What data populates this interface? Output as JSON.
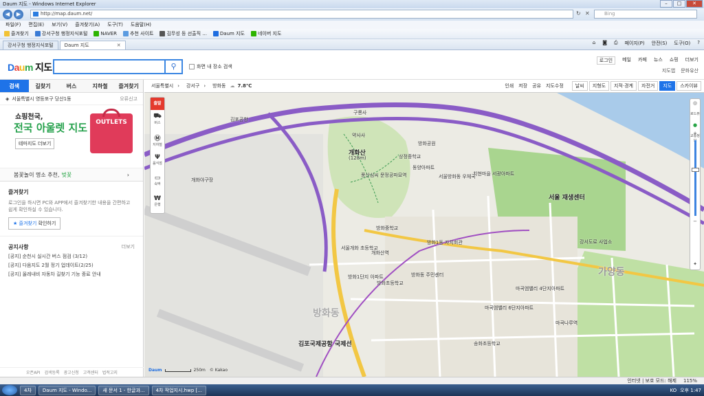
{
  "window": {
    "title": "Daum 지도 - Windows Internet Explorer"
  },
  "addressbar": {
    "url": "http://map.daum.net/",
    "search_placeholder": "Bing"
  },
  "menubar": {
    "items": [
      "파일(F)",
      "편집(E)",
      "보기(V)",
      "즐겨찾기(A)",
      "도구(T)",
      "도움말(H)"
    ]
  },
  "favbar": {
    "favorites_label": "즐겨찾기",
    "items": [
      "강서구청 행정지식포털",
      "NAVER",
      "추천 사이트",
      "김무성 등 선출직 ...",
      "Daum 지도",
      "네이버 지도"
    ]
  },
  "tabs": [
    {
      "label": "강서구청 행정지식포털"
    },
    {
      "label": "Daum 지도"
    }
  ],
  "commandbar": {
    "items": [
      "페이지(P)",
      "안전(S)",
      "도구(O)"
    ]
  },
  "daum": {
    "logo_text": "지도",
    "checkbox_label": "화면 내 장소 검색",
    "toplinks": [
      "로그인",
      "메일",
      "카페",
      "뉴스",
      "쇼핑",
      "더보기"
    ],
    "sublinks": [
      "지도앱",
      "문화유산"
    ]
  },
  "leftpanel": {
    "navtabs": [
      "검색",
      "길찾기",
      "버스",
      "지하철",
      "즐겨찾기"
    ],
    "location": "서울특별시 영등포구 당산1동",
    "report": "오류신고",
    "banner": {
      "line1": "쇼핑천국,",
      "line2": "전국 아울렛 지도",
      "button": "테마지도 더보기",
      "bag_text": "OUTLETS"
    },
    "promo": {
      "text": "봄꽃놀이 명소 추천,",
      "highlight": "벚꽃"
    },
    "favorites": {
      "heading": "즐겨찾기",
      "desc": "로그인을 하시면 PC와 APP에서 즐겨찾기한 내용을 간편하고 쉽게 확인하실 수 있습니다.",
      "btn_highlight": "즐겨찾기",
      "btn_rest": "확인하기"
    },
    "notice": {
      "heading": "공지사항",
      "more": "더보기",
      "items": [
        "[공지] 순천시 실시간 버스 점검 (3/12)",
        "[공지] 다음지도 2월 정기 업데이트(2/25)",
        "[공지] 올레내비 자동차 길찾기 기능 종료 안내"
      ]
    },
    "footer": [
      "오픈API",
      "검색등록",
      "광고신청",
      "고객센터",
      "법적고지"
    ]
  },
  "mapbar": {
    "crumbs": [
      "서울특별시",
      "강서구",
      "방화동"
    ],
    "temperature": "7.8℃",
    "tools": [
      "인쇄",
      "저장",
      "공유",
      "지도수정"
    ],
    "modes": [
      "날씨",
      "지형도",
      "지적·경계",
      "자전거",
      "지도",
      "스카이뷰"
    ],
    "active_mode": "지도"
  },
  "maptools": {
    "start": "출발",
    "items": [
      "버스",
      "지하철",
      "음식점",
      "숙박",
      "은행"
    ]
  },
  "zoom": {
    "controls": [
      "로드뷰",
      "교통정보"
    ]
  },
  "map": {
    "labels": [
      "김포공항",
      "개화산",
      "(128m)",
      "약사사",
      "풍산심씨 문정공파묘역",
      "개화야구장",
      "서울방화동 우체국",
      "방화공원",
      "상정중학교",
      "동양아파트",
      "치현마을 서광아파트",
      "서울 재생센터",
      "방화1동 자치회관",
      "방화중학교",
      "서울개화 초등학교",
      "방화1단지 아파트",
      "방화동 주민센터",
      "김포국제공항 국제선",
      "마곡엠밸리 6단지아파트",
      "마곡엠밸리 4단지아파트",
      "강서도로 사업소",
      "방화초등학교",
      "송화초등학교",
      "개화산역",
      "구룡사",
      "마곡나루역",
      "가양동",
      "방화동"
    ],
    "scale_label": "250m",
    "copyright": "© Kakao",
    "brand": "Daum"
  },
  "statusbar": {
    "zone": "인터넷 | 보호 모드: 해제",
    "zoom": "115%"
  },
  "taskbar": {
    "items": [
      "4차",
      "Daum 지도 - Windo...",
      "새 문서 1 - 한글과...",
      "4차 작업지시.hwp [..."
    ],
    "lang": "KO",
    "clock": "오후 1:47"
  },
  "colors": {
    "accent": "#1e73e8",
    "daum_blue": "#1e6de0",
    "outlet_red": "#e03b5a",
    "park_green": "#a9d58f",
    "expressway_purple": "#8a5cc6",
    "river_blue": "#a9cbea"
  }
}
